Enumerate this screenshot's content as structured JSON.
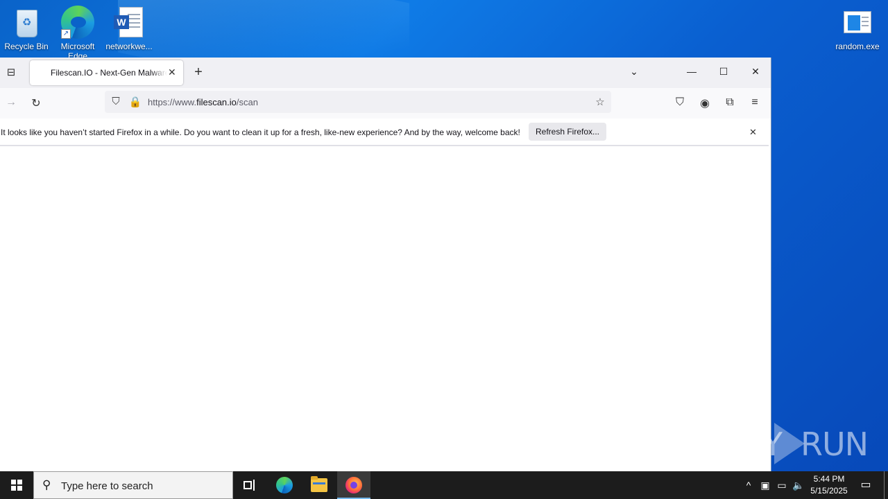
{
  "desktop": {
    "icons": [
      {
        "label": "Recycle Bin"
      },
      {
        "label": "Microsoft Edge"
      },
      {
        "label": "networkwe..."
      },
      {
        "label": "random.exe"
      }
    ]
  },
  "browser": {
    "tab": {
      "title": "Filescan.IO - Next-Gen Malware Analysis Platform"
    },
    "url": {
      "prefix": "https://www.",
      "domain": "filescan.io",
      "path": "/scan"
    },
    "notification": {
      "message": "It looks like you haven’t started Firefox in a while. Do you want to clean it up for a fresh, like-new experience? And by the way, welcome back!",
      "button": "Refresh Firefox..."
    }
  },
  "watermark": {
    "left": "ANY",
    "right": "RUN"
  },
  "taskbar": {
    "search_placeholder": "Type here to search",
    "clock": {
      "time": "5:44 PM",
      "date": "5/15/2025"
    }
  },
  "icons": {
    "tab_list": "tab-list-icon",
    "new_tab": "plus-icon",
    "shield": "tracking-shield-icon",
    "lock": "lock-icon",
    "bookmark": "star-icon",
    "pocket": "pocket-icon",
    "account": "account-icon",
    "extensions": "puzzle-icon",
    "menu": "hamburger-icon"
  }
}
